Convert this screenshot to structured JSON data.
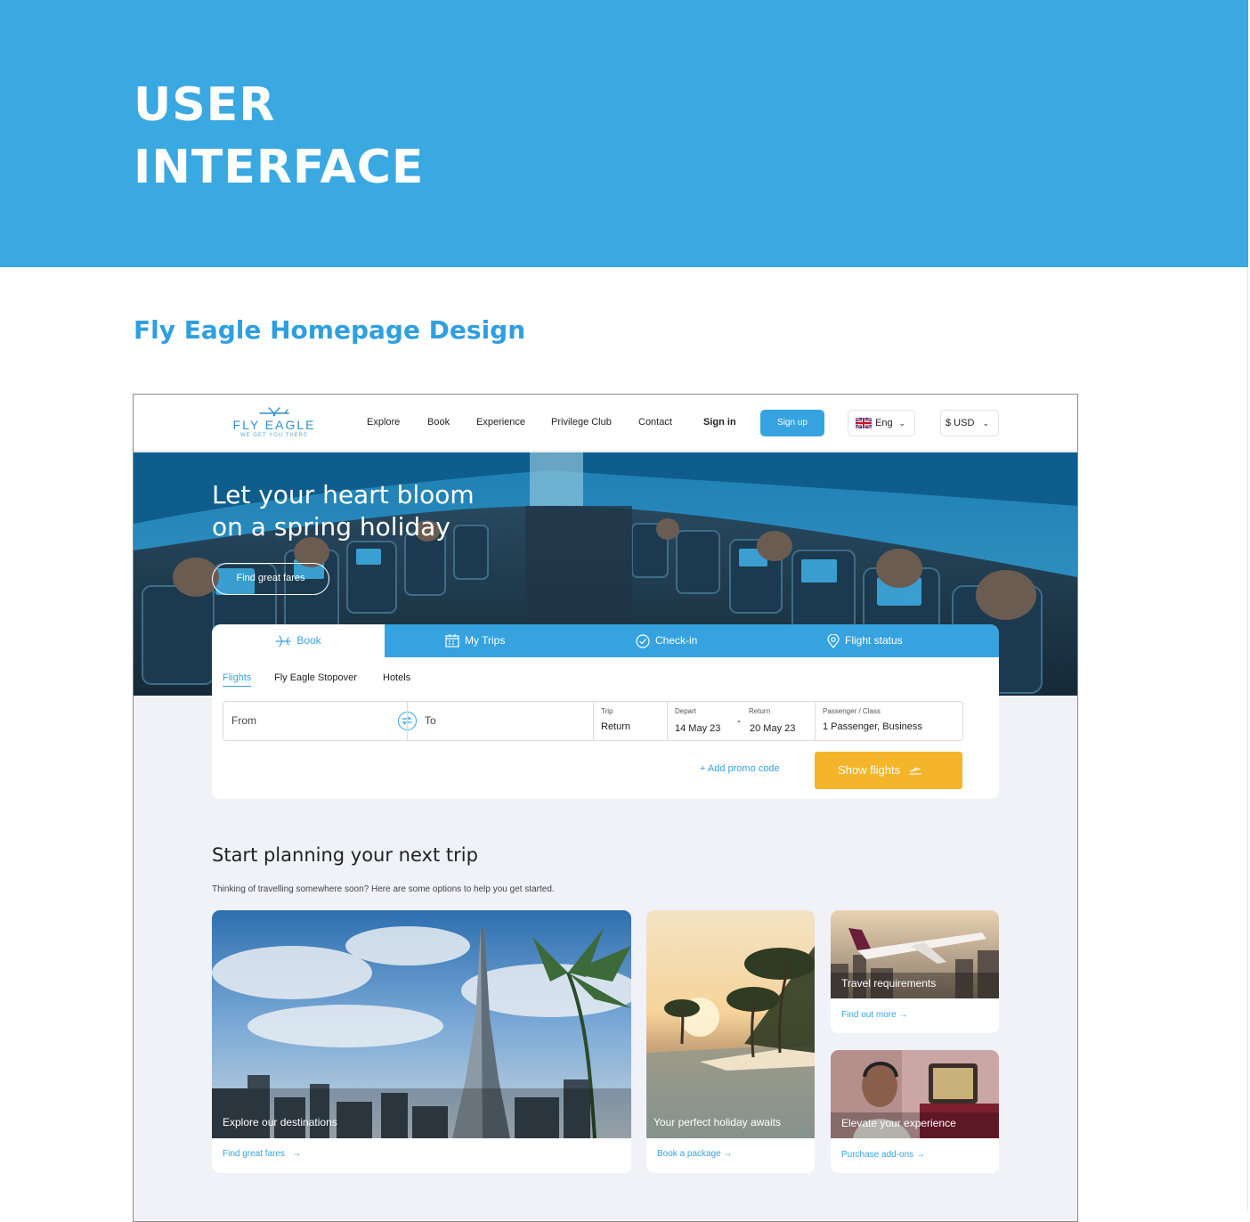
{
  "banner": {
    "line1": "USER",
    "line2": "INTERFACE"
  },
  "section_title": "Fly Eagle Homepage Design",
  "site": {
    "logo": {
      "name": "FLY EAGLE",
      "tagline": "WE GET YOU THERE"
    },
    "nav": {
      "explore": "Explore",
      "book": "Book",
      "experience": "Experience",
      "privilege": "Privilege Club",
      "contact": "Contact"
    },
    "sign_in": "Sign in",
    "sign_up": "Sign up",
    "language": "Eng",
    "currency": "$ USD"
  },
  "hero": {
    "line1": "Let your heart bloom",
    "line2": "on a spring holiday",
    "button": "Find great fares"
  },
  "booking": {
    "tabs": {
      "book": "Book",
      "trips": "My Trips",
      "checkin": "Check-in",
      "status": "Flight status"
    },
    "subtabs": {
      "flights": "Flights",
      "stopover": "Fly Eagle Stopover",
      "hotels": "Hotels"
    },
    "from_placeholder": "From",
    "to_placeholder": "To",
    "trip": {
      "label": "Trip",
      "value": "Return"
    },
    "depart": {
      "label": "Depart",
      "value": "14 May 23"
    },
    "return": {
      "label": "Return",
      "value": "20 May 23"
    },
    "passenger": {
      "label": "Passenger / Class",
      "value": "1 Passenger, Business"
    },
    "promo": "+ Add promo code",
    "show_flights": "Show flights"
  },
  "planning": {
    "title": "Start planning your next trip",
    "subtitle": "Thinking of travelling somewhere soon? Here are some options to help you get started."
  },
  "cards": {
    "destinations": {
      "caption": "Explore our destinations",
      "link": "Find great fares"
    },
    "holiday": {
      "caption": "Your perfect holiday awaits",
      "link": "Book a package"
    },
    "requirements": {
      "caption": "Travel requirements",
      "link": "Find out more"
    },
    "experience": {
      "caption": "Elevate your experience",
      "link": "Purchase add-ons"
    }
  },
  "colors": {
    "brand_blue": "#36a3e0",
    "banner_blue": "#3aa8e1",
    "cta_yellow": "#f5b52a"
  }
}
